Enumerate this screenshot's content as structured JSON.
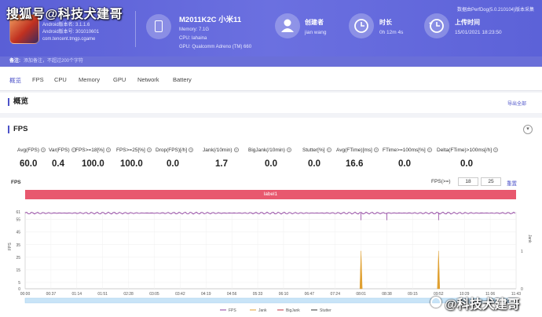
{
  "watermark_top": "搜狐号@科技犬建哥",
  "watermark_bottom": "@科技犬建哥",
  "app": {
    "android_version": "Android版本名: 3.1.1.6",
    "android_code": "Android版本号: 301010601",
    "package": "com.tencent.tmgp.cgame"
  },
  "device": {
    "title": "M2011K2C 小米11",
    "memory": "Memory: 7.1G",
    "cpu": "CPU: lahaina",
    "gpu": "GPU: Qualcomm Adreno (TM) 660"
  },
  "stats": {
    "creator_label": "创建者",
    "creator_value": "jian wang",
    "duration_label": "时长",
    "duration_value": "0h 12m 4s",
    "upload_label": "上传时间",
    "upload_value": "15/01/2021 18:23:50"
  },
  "perfdog_note": "数据由PerfDog(5.0.210104)版本采集",
  "note": {
    "label": "备注:",
    "placeholder": "添加备注，不超过200个字符"
  },
  "tabs": [
    "概览",
    "FPS",
    "CPU",
    "Memory",
    "GPU",
    "Network",
    "Battery"
  ],
  "overview": {
    "title": "概览",
    "export": "导出全部"
  },
  "fps_panel": {
    "title": "FPS",
    "collapse": "▾"
  },
  "metrics": [
    {
      "label": "Avg(FPS)",
      "value": "60.0"
    },
    {
      "label": "Var(FPS)",
      "value": "0.4"
    },
    {
      "label": "FPS>=18[%]",
      "value": "100.0"
    },
    {
      "label": "FPS>=25[%]",
      "value": "100.0"
    },
    {
      "label": "Drop(FPS)[/h]",
      "value": "0.0"
    },
    {
      "label": "Jank(/10min)",
      "value": "1.7"
    },
    {
      "label": "BigJank(/10min)",
      "value": "0.0"
    },
    {
      "label": "Stutter[%]",
      "value": "0.0"
    },
    {
      "label": "Avg(FTime)[ms]",
      "value": "16.6"
    },
    {
      "label": "FTime>=100ms[%]",
      "value": "0.0"
    },
    {
      "label": "Delta(FTime)>100ms[/h]",
      "value": "0.0"
    }
  ],
  "chart_ui": {
    "chart_title": "FPS",
    "threshold_label": "FPS(>=)",
    "threshold_1": "18",
    "threshold_2": "25",
    "reset": "重置",
    "label_bar": "label1"
  },
  "chart_data": {
    "type": "line",
    "title": "",
    "ylabel": "FPS",
    "ylabel_right": "Jank",
    "ylim": [
      0,
      61
    ],
    "y_ticks": [
      "61",
      "55",
      "45",
      "35",
      "25",
      "15",
      "5",
      "0"
    ],
    "y_ticks_right": [
      "1",
      "0"
    ],
    "x_ticks": [
      "00:00",
      "00:37",
      "01:14",
      "01:51",
      "02:28",
      "03:05",
      "03:42",
      "04:19",
      "04:56",
      "05:33",
      "06:10",
      "06:47",
      "07:24",
      "08:01",
      "08:38",
      "09:15",
      "09:52",
      "10:29",
      "11:06",
      "11:43"
    ],
    "series": [
      {
        "name": "FPS",
        "color": "#8e3f9e",
        "value": 60
      },
      {
        "name": "Jank",
        "color": "#e0a030",
        "events": [
          "08:01",
          "09:52"
        ]
      },
      {
        "name": "BigJank",
        "color": "#c03040"
      },
      {
        "name": "Stutter",
        "color": "#333333"
      }
    ],
    "fps_markers": [
      "08:01",
      "08:38",
      "09:52"
    ],
    "grid": true,
    "legend_position": "bottom"
  }
}
